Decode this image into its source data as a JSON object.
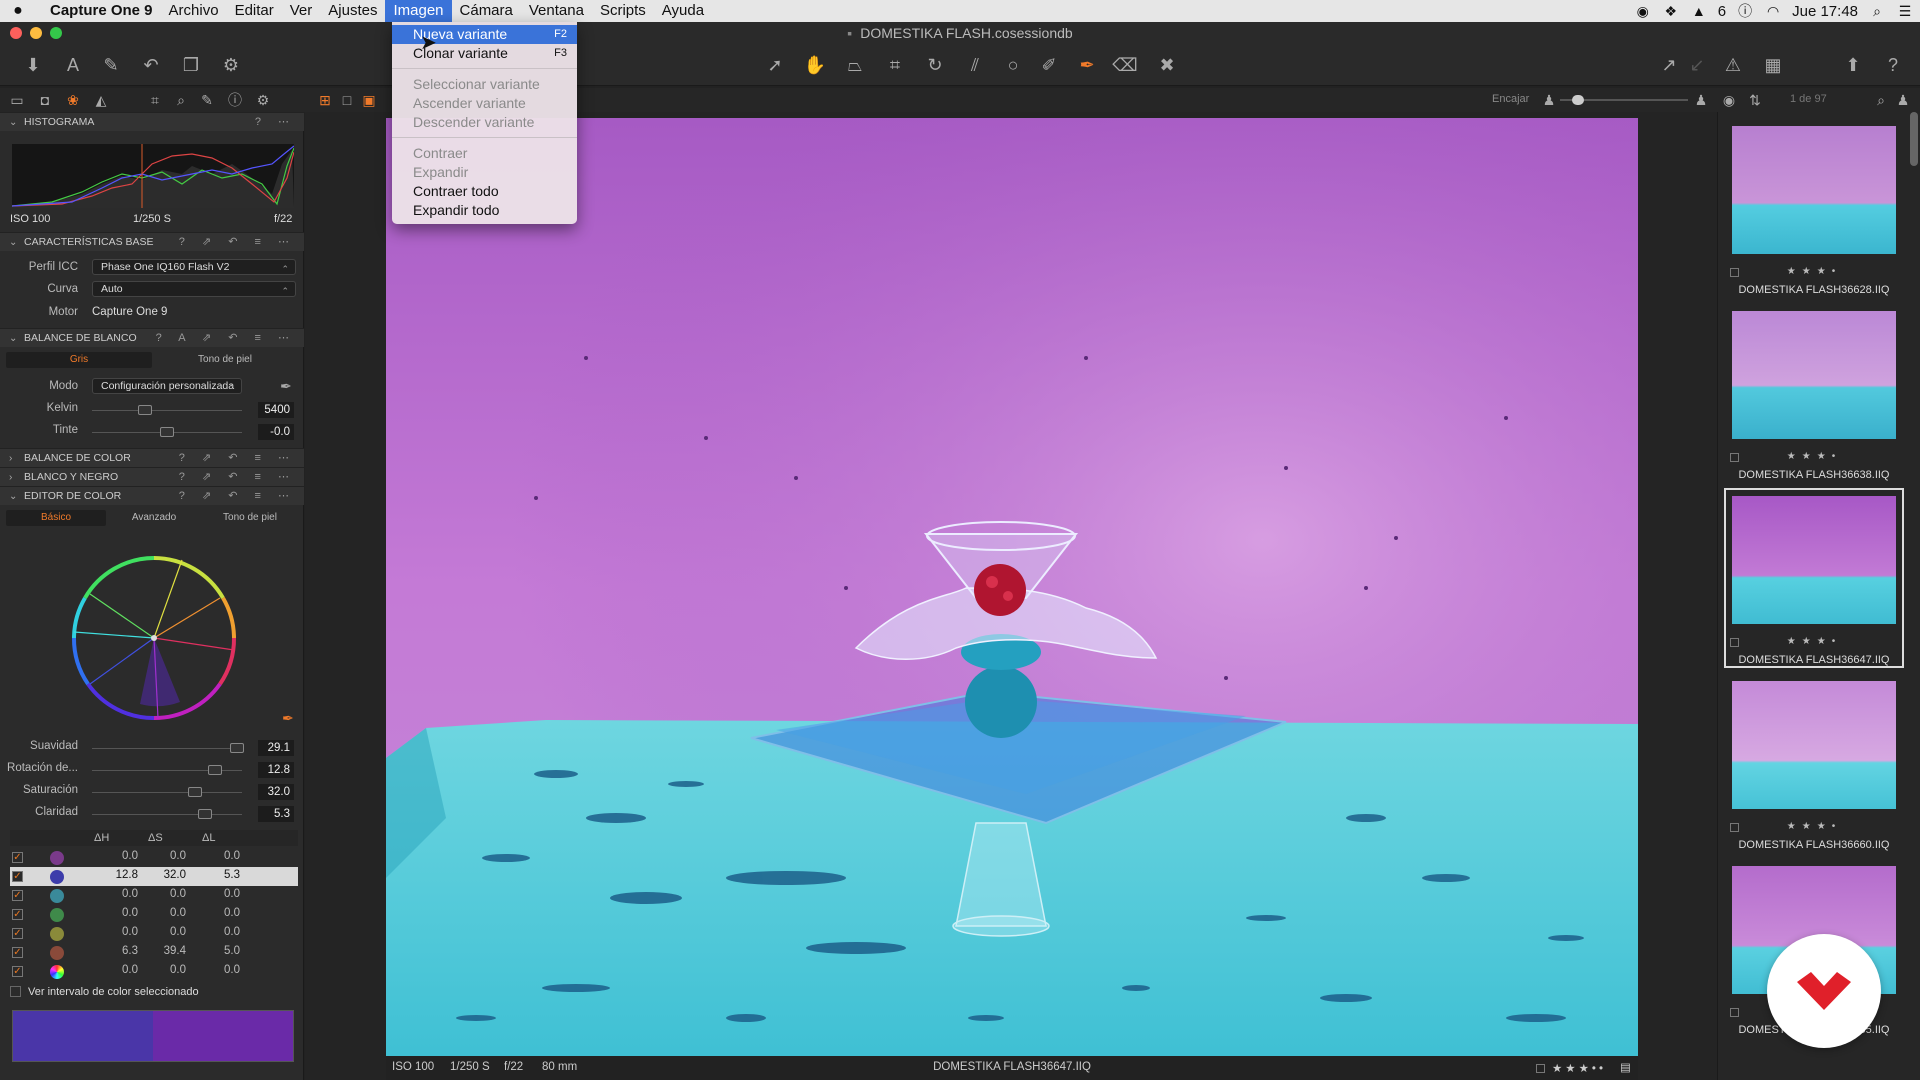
{
  "menubar": {
    "apple": "",
    "app_name": "Capture One 9",
    "items": [
      "Archivo",
      "Editar",
      "Ver",
      "Ajustes",
      "Imagen",
      "Cámara",
      "Ventana",
      "Scripts",
      "Ayuda"
    ],
    "status": {
      "clock": "Jue 17:48",
      "wifi_count": "6"
    }
  },
  "window": {
    "title": "DOMESTIKA FLASH.cosessiondb"
  },
  "dropdown": {
    "items": [
      {
        "label": "Nueva variante",
        "key": "F2",
        "state": "selected"
      },
      {
        "label": "Clonar variante",
        "key": "F3",
        "state": "enabled"
      },
      {
        "label": "Seleccionar variante",
        "key": "",
        "state": "disabled"
      },
      {
        "label": "Ascender variante",
        "key": "",
        "state": "disabled"
      },
      {
        "label": "Descender variante",
        "key": "",
        "state": "disabled"
      },
      {
        "label": "Contraer",
        "key": "",
        "state": "disabled"
      },
      {
        "label": "Expandir",
        "key": "",
        "state": "disabled"
      },
      {
        "label": "Contraer todo",
        "key": "",
        "state": "enabled"
      },
      {
        "label": "Expandir todo",
        "key": "",
        "state": "enabled"
      }
    ]
  },
  "viewer_bar": {
    "fit_label": "Encajar",
    "counter": "1 de 97"
  },
  "histogram": {
    "title": "HISTOGRAMA",
    "iso": "ISO 100",
    "shutter": "1/250 S",
    "aperture": "f/22"
  },
  "base": {
    "title": "CARACTERÍSTICAS BASE",
    "icc_label": "Perfil ICC",
    "icc_value": "Phase One IQ160 Flash V2",
    "curve_label": "Curva",
    "curve_value": "Auto",
    "engine_label": "Motor",
    "engine_value": "Capture One 9"
  },
  "white_balance": {
    "title": "BALANCE DE BLANCO",
    "tabs": [
      "Gris",
      "Tono de piel"
    ],
    "mode_label": "Modo",
    "mode_value": "Configuración personalizada",
    "kelvin_label": "Kelvin",
    "kelvin_value": "5400",
    "kelvin_level": 0.35,
    "tint_label": "Tinte",
    "tint_value": "-0.0",
    "tint_level": 0.5
  },
  "collapsed_sections": [
    "BALANCE DE COLOR",
    "BLANCO Y NEGRO"
  ],
  "color_editor": {
    "title": "EDITOR DE COLOR",
    "tabs": [
      "Básico",
      "Avanzado",
      "Tono de piel"
    ],
    "sliders": [
      {
        "label": "Suavidad",
        "value": "29.1"
      },
      {
        "label": "Rotación de...",
        "value": "12.8"
      },
      {
        "label": "Saturación",
        "value": "32.0"
      },
      {
        "label": "Claridad",
        "value": "5.3"
      }
    ],
    "columns": [
      "ΔH",
      "ΔS",
      "ΔL"
    ],
    "rows": [
      {
        "dh": "0.0",
        "ds": "0.0",
        "dl": "0.0",
        "color": "#7a3a8a"
      },
      {
        "dh": "12.8",
        "ds": "32.0",
        "dl": "5.3",
        "color": "#3c3caa"
      },
      {
        "dh": "0.0",
        "ds": "0.0",
        "dl": "0.0",
        "color": "#3a8a9a"
      },
      {
        "dh": "0.0",
        "ds": "0.0",
        "dl": "0.0",
        "color": "#3f8a4a"
      },
      {
        "dh": "0.0",
        "ds": "0.0",
        "dl": "0.0",
        "color": "#8a8a3a"
      },
      {
        "dh": "6.3",
        "ds": "39.4",
        "dl": "5.0",
        "color": "#8a4a3a"
      },
      {
        "dh": "0.0",
        "ds": "0.0",
        "dl": "0.0",
        "color": "rainbow"
      }
    ],
    "show_range_label": "Ver intervalo de color seleccionado",
    "preview_colors": [
      "#4a36a8",
      "#6a2aa8"
    ]
  },
  "viewer_footer": {
    "iso": "ISO 100",
    "shutter": "1/250 S",
    "aperture": "f/22",
    "focal": "80 mm",
    "filename": "DOMESTIKA FLASH36647.IIQ",
    "rating": "★★★••"
  },
  "browser": {
    "thumbs": [
      {
        "name": "DOMESTIKA FLASH36628.IIQ",
        "rating": "★★★•",
        "selected": false
      },
      {
        "name": "DOMESTIKA FLASH36638.IIQ",
        "rating": "★★★•",
        "selected": false
      },
      {
        "name": "DOMESTIKA FLASH36647.IIQ",
        "rating": "★★★•",
        "selected": true
      },
      {
        "name": "DOMESTIKA FLASH36660.IIQ",
        "rating": "★★★•",
        "selected": false
      },
      {
        "name": "DOMESTIKA FLASH36665.IIQ",
        "rating": "",
        "selected": false
      }
    ]
  }
}
